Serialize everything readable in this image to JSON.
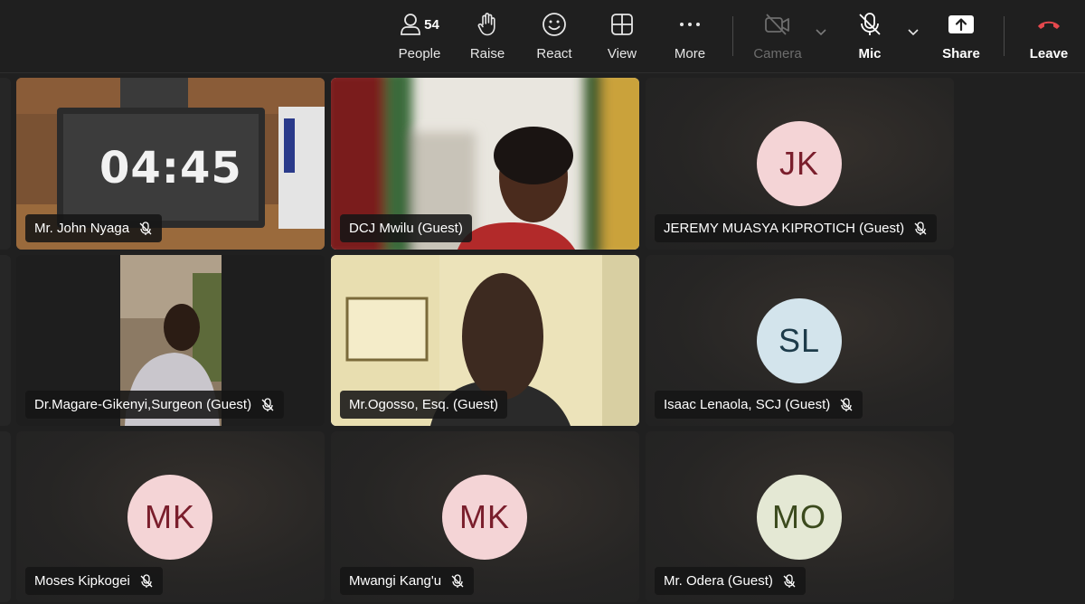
{
  "toolbar": {
    "people_label": "People",
    "people_count": "54",
    "raise_label": "Raise",
    "react_label": "React",
    "view_label": "View",
    "more_label": "More",
    "camera_label": "Camera",
    "mic_label": "Mic",
    "share_label": "Share",
    "leave_label": "Leave"
  },
  "participants": [
    {
      "name": "Mr. John Nyaga",
      "video": true,
      "timer": "04:45"
    },
    {
      "name": "DCJ Mwilu (Guest)",
      "video": true
    },
    {
      "name": "JEREMY MUASYA KIPROTICH (Guest)",
      "initials": "JK"
    },
    {
      "name": "Dr.Magare-Gikenyi,Surgeon (Guest)",
      "video": true
    },
    {
      "name": "Mr.Ogosso, Esq. (Guest)",
      "video": true,
      "active_speaker": true
    },
    {
      "name": "Isaac Lenaola, SCJ (Guest)",
      "initials": "SL"
    },
    {
      "name": "Moses Kipkogei",
      "initials": "MK"
    },
    {
      "name": "Mwangi Kang'u",
      "initials": "MK"
    },
    {
      "name": "Mr. Odera (Guest)",
      "initials": "MO"
    }
  ],
  "colors": {
    "leave_red": "#e5484d",
    "active_outline": "#7f85f5",
    "avatar_pink_bg": "#f4d4d6",
    "avatar_pink_text": "#7a1e2c",
    "avatar_blue_bg": "#d3e4ec",
    "avatar_blue_text": "#1d3b4a",
    "avatar_olive_bg": "#e4e8d4",
    "avatar_olive_text": "#3b4a1d"
  }
}
